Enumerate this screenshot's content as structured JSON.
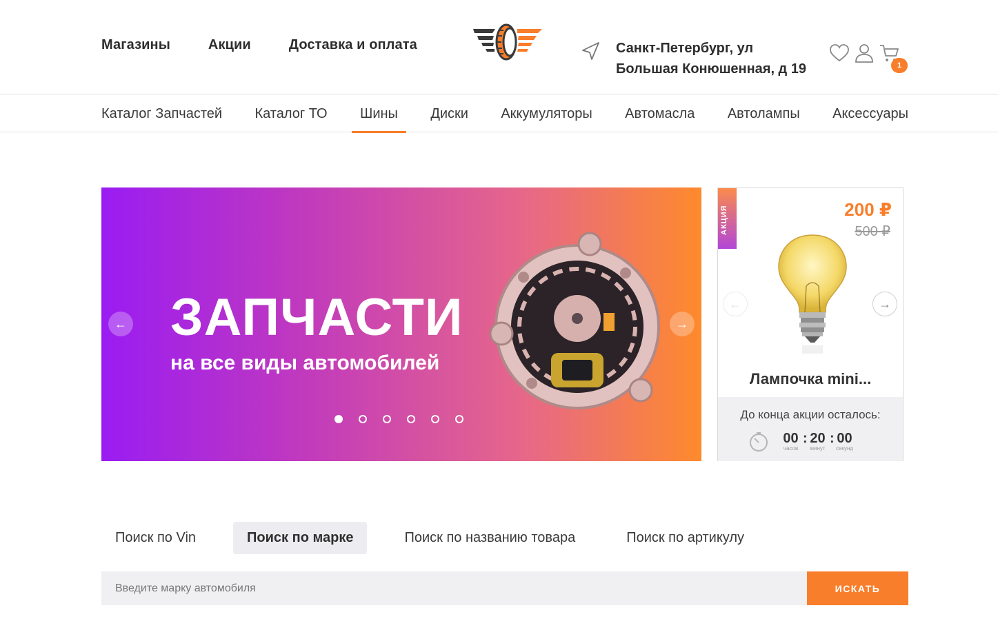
{
  "header": {
    "nav": [
      "Магазины",
      "Акции",
      "Доставка и оплата"
    ],
    "address_line1": "Санкт-Петербург, ул",
    "address_line2": "Большая Конюшенная, д 19",
    "cart_count": "1",
    "icons": [
      "location-arrow-icon",
      "heart-icon",
      "user-icon",
      "cart-icon"
    ]
  },
  "catalog_nav": {
    "items": [
      "Каталог Запчастей",
      "Каталог ТО",
      "Шины",
      "Диски",
      "Аккумуляторы",
      "Автомасла",
      "Автолампы",
      "Аксессуары"
    ],
    "active": "Шины"
  },
  "banner": {
    "title": "ЗАПЧАСТИ",
    "subtitle": "на все виды автомобилей",
    "prev_icon": "←",
    "next_icon": "→",
    "slide_count": 6,
    "active_slide": 1
  },
  "promo": {
    "tag": "АКЦИЯ",
    "price_new": "200 ₽",
    "price_old": "500 ₽",
    "name": "Лампочка mini...",
    "timer_label": "До конца акции осталось:",
    "hours": "00",
    "minutes": "20",
    "seconds": "00",
    "hours_unit": "часов",
    "minutes_unit": "минут",
    "seconds_unit": "секунд",
    "prev_icon": "←",
    "next_icon": "→"
  },
  "search": {
    "tabs": [
      "Поиск по Vin",
      "Поиск по марке",
      "Поиск по названию товара",
      "Поиск по артикулу"
    ],
    "active_tab": "Поиск по марке",
    "placeholder": "Введите марку автомобиля",
    "button": "ИСКАТЬ"
  },
  "colors": {
    "accent": "#f97e2b",
    "banner_start": "#9a1cf2",
    "banner_end": "#fe8a2c"
  }
}
